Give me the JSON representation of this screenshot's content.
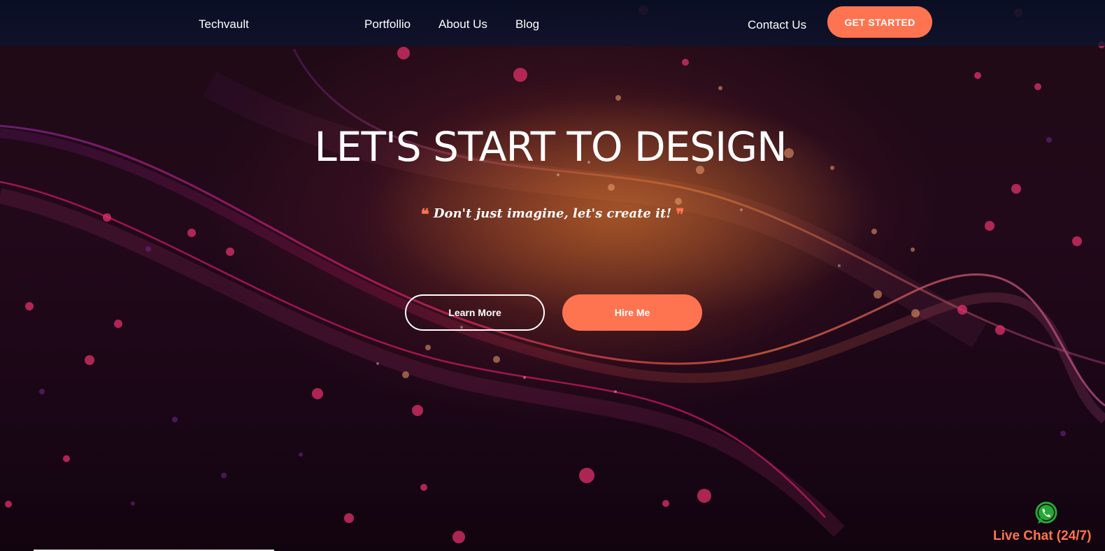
{
  "nav": {
    "brand": "Techvault",
    "links": [
      "Portfollio",
      "About Us",
      "Blog"
    ],
    "contact": "Contact Us",
    "cta": "GET STARTED"
  },
  "hero": {
    "title": "LET'S START TO DESIGN",
    "quote_open": "❝",
    "quote": "Don't just imagine, let's create it!",
    "quote_close": "❞",
    "learn_more": "Learn More",
    "hire_me": "Hire Me"
  },
  "live_chat": {
    "label": "Live Chat (24/7)",
    "icon": "whatsapp-icon"
  },
  "colors": {
    "accent": "#ff7450",
    "whatsapp": "#25a836",
    "nav_bg": "#0b1230"
  }
}
